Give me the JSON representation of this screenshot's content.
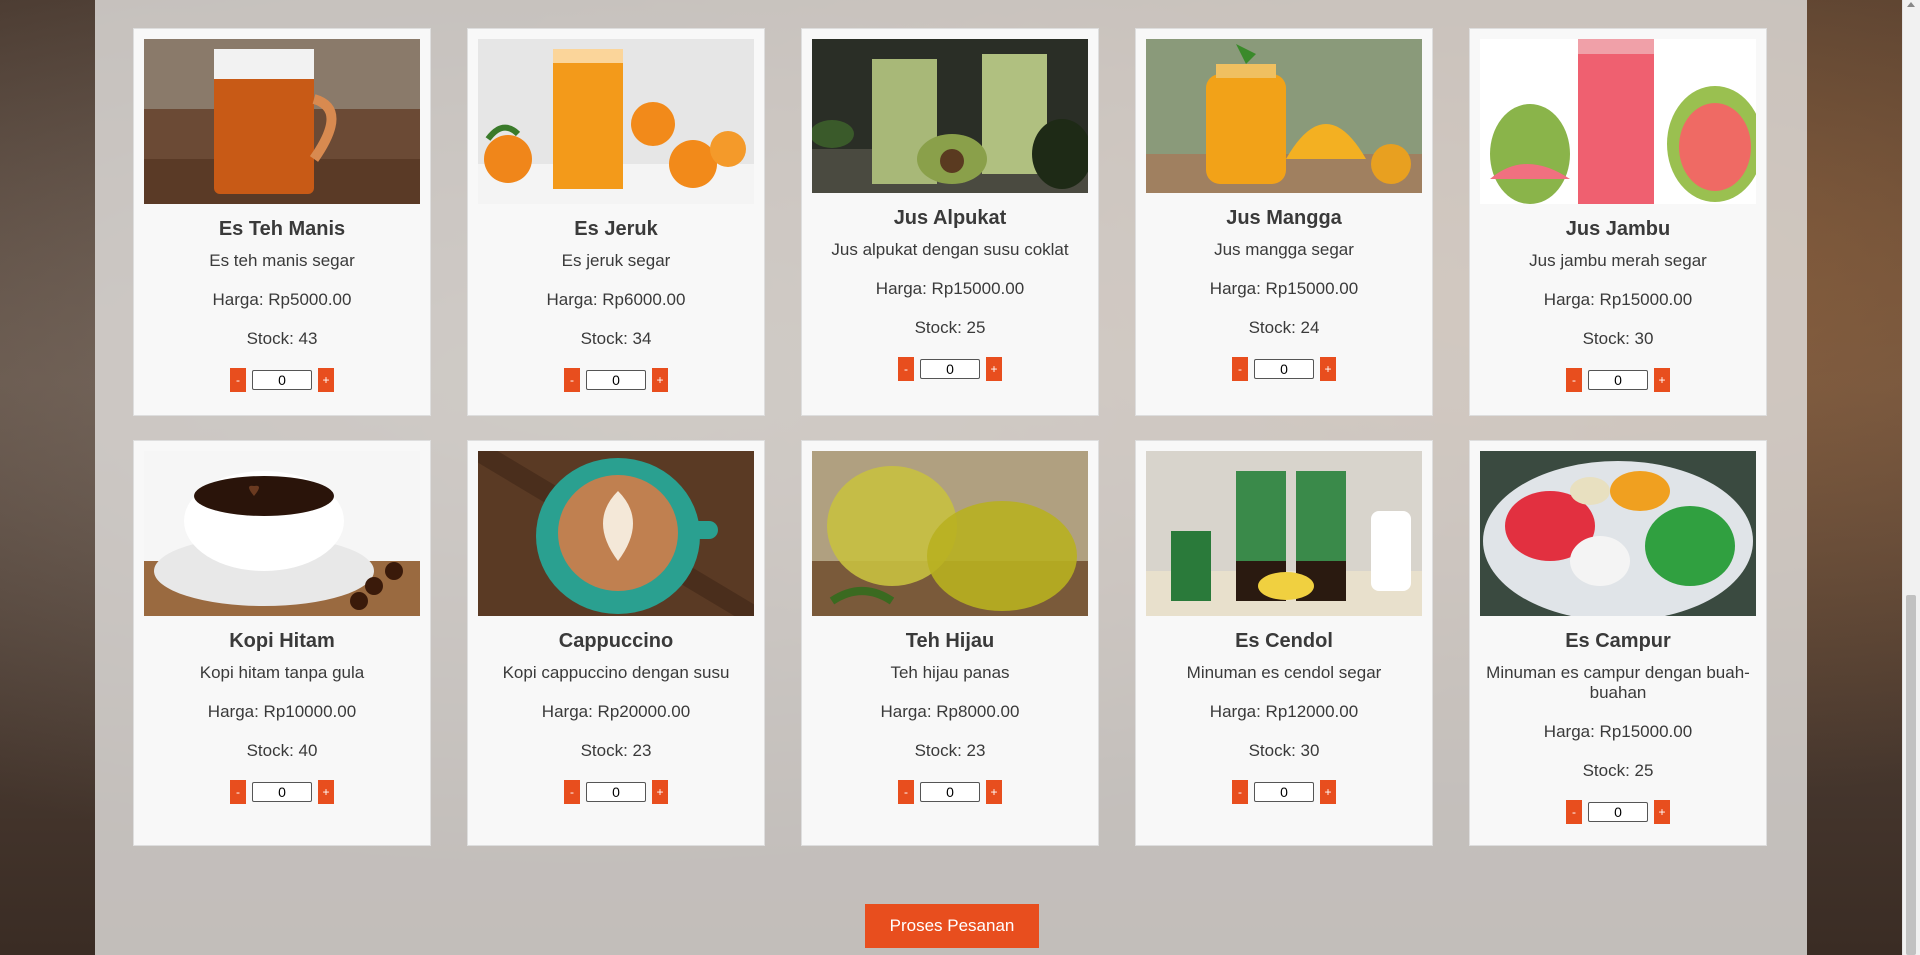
{
  "products_row1": [
    {
      "name": "Es Teh Manis",
      "desc": "Es teh manis segar",
      "price": "Harga: Rp5000.00",
      "stock": "Stock: 43",
      "qty": "0",
      "image": "iced-tea-jar-image"
    },
    {
      "name": "Es Jeruk",
      "desc": "Es jeruk segar",
      "price": "Harga: Rp6000.00",
      "stock": "Stock: 34",
      "qty": "0",
      "image": "orange-juice-image"
    },
    {
      "name": "Jus Alpukat",
      "desc": "Jus alpukat dengan susu coklat",
      "price": "Harga: Rp15000.00",
      "stock": "Stock: 25",
      "qty": "0",
      "image": "avocado-juice-image"
    },
    {
      "name": "Jus Mangga",
      "desc": "Jus mangga segar",
      "price": "Harga: Rp15000.00",
      "stock": "Stock: 24",
      "qty": "0",
      "image": "mango-juice-image"
    },
    {
      "name": "Jus Jambu",
      "desc": "Jus jambu merah segar",
      "price": "Harga: Rp15000.00",
      "stock": "Stock: 30",
      "qty": "0",
      "image": "guava-juice-image"
    }
  ],
  "products_row2": [
    {
      "name": "Kopi Hitam",
      "desc": "Kopi hitam tanpa gula",
      "price": "Harga: Rp10000.00",
      "stock": "Stock: 40",
      "qty": "0",
      "image": "black-coffee-image"
    },
    {
      "name": "Cappuccino",
      "desc": "Kopi cappuccino dengan susu",
      "price": "Harga: Rp20000.00",
      "stock": "Stock: 23",
      "qty": "0",
      "image": "cappuccino-image"
    },
    {
      "name": "Teh Hijau",
      "desc": "Teh hijau panas",
      "price": "Harga: Rp8000.00",
      "stock": "Stock: 23",
      "qty": "0",
      "image": "green-tea-image"
    },
    {
      "name": "Es Cendol",
      "desc": "Minuman es cendol segar",
      "price": "Harga: Rp12000.00",
      "stock": "Stock: 30",
      "qty": "0",
      "image": "cendol-image"
    },
    {
      "name": "Es Campur",
      "desc": "Minuman es campur dengan buah-buahan",
      "price": "Harga: Rp15000.00",
      "stock": "Stock: 25",
      "qty": "0",
      "image": "es-campur-image"
    }
  ],
  "qty_controls": {
    "minus": "-",
    "plus": "+"
  },
  "submit_label": "Proses Pesanan",
  "colors": {
    "accent": "#e84e1e"
  }
}
